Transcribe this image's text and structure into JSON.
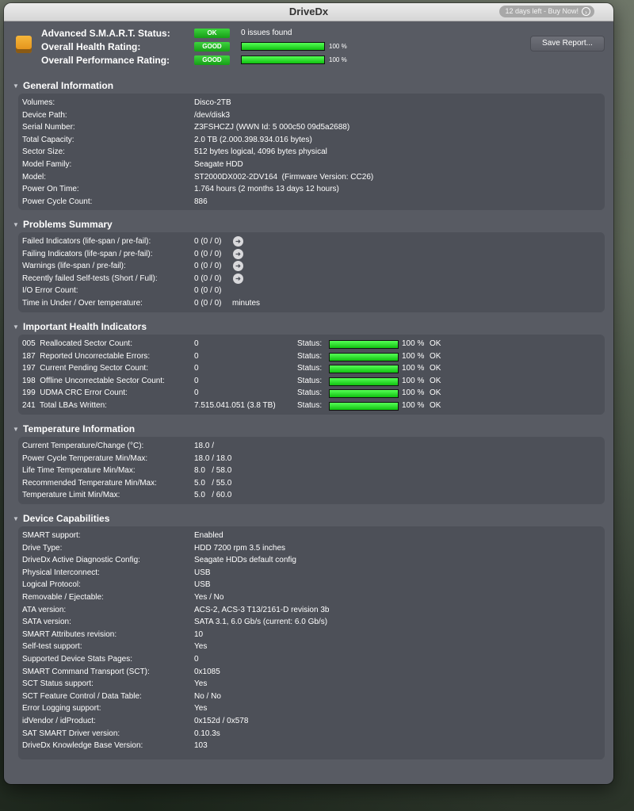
{
  "window": {
    "title": "DriveDx",
    "buy_text": "12 days left - Buy Now!"
  },
  "status": {
    "smart_label": "Advanced S.M.A.R.T. Status:",
    "smart_badge": "OK",
    "smart_issues": "0 issues found",
    "health_label": "Overall Health Rating:",
    "health_badge": "GOOD",
    "health_pct_text": "100 %",
    "health_value": 100,
    "perf_label": "Overall Performance Rating:",
    "perf_badge": "GOOD",
    "perf_pct_text": "100 %",
    "perf_value": 100,
    "save_label": "Save Report..."
  },
  "colors": {
    "good_green": "#2ebf2e",
    "bar_green": "#22e022",
    "panel": "#4d5058",
    "window": "#585b63"
  },
  "general": {
    "title": "General Information",
    "rows": [
      {
        "label": "Volumes:",
        "value": "Disco-2TB"
      },
      {
        "label": "Device Path:",
        "value": "/dev/disk3"
      },
      {
        "label": "Serial Number:",
        "value": "Z3FSHCZJ (WWN Id: 5 000c50 09d5a2688)"
      },
      {
        "label": "Total Capacity:",
        "value": "2.0 TB (2.000.398.934.016 bytes)"
      },
      {
        "label": "Sector Size:",
        "value": "512 bytes logical, 4096 bytes physical"
      },
      {
        "label": "Model Family:",
        "value": "Seagate HDD"
      },
      {
        "label": "Model:",
        "value": "ST2000DX002-2DV164  (Firmware Version: CC26)"
      },
      {
        "label": "Power On Time:",
        "value": "1.764 hours (2 months 13 days 12 hours)"
      },
      {
        "label": "Power Cycle Count:",
        "value": "886"
      }
    ]
  },
  "problems": {
    "title": "Problems Summary",
    "rows": [
      {
        "label": "Failed Indicators (life-span / pre-fail):",
        "value": "0 (0 / 0)",
        "icon": "go-arrow-icon",
        "unit": ""
      },
      {
        "label": "Failing Indicators (life-span / pre-fail):",
        "value": "0 (0 / 0)",
        "icon": "go-arrow-icon",
        "unit": ""
      },
      {
        "label": "Warnings (life-span / pre-fail):",
        "value": "0 (0 / 0)",
        "icon": "go-arrow-icon",
        "unit": ""
      },
      {
        "label": "Recently failed Self-tests (Short / Full):",
        "value": "0 (0 / 0)",
        "icon": "go-arrow-icon",
        "unit": ""
      },
      {
        "label": "I/O Error Count:",
        "value": "0 (0 / 0)",
        "icon": "",
        "unit": ""
      },
      {
        "label": "Time in Under / Over temperature:",
        "value": "0 (0 / 0)",
        "icon": "",
        "unit": "minutes"
      }
    ]
  },
  "health": {
    "title": "Important Health Indicators",
    "rows": [
      {
        "label": "005  Reallocated Sector Count:",
        "value": "0",
        "status_label": "Status:",
        "pct_text": "100 %",
        "pct": 100,
        "state": "OK"
      },
      {
        "label": "187  Reported Uncorrectable Errors:",
        "value": "0",
        "status_label": "Status:",
        "pct_text": "100 %",
        "pct": 100,
        "state": "OK"
      },
      {
        "label": "197  Current Pending Sector Count:",
        "value": "0",
        "status_label": "Status:",
        "pct_text": "100 %",
        "pct": 100,
        "state": "OK"
      },
      {
        "label": "198  Offline Uncorrectable Sector Count:",
        "value": "0",
        "status_label": "Status:",
        "pct_text": "100 %",
        "pct": 100,
        "state": "OK"
      },
      {
        "label": "199  UDMA CRC Error Count:",
        "value": "0",
        "status_label": "Status:",
        "pct_text": "100 %",
        "pct": 100,
        "state": "OK"
      },
      {
        "label": "241  Total LBAs Written:",
        "value": "7.515.041.051 (3.8 TB)",
        "status_label": "Status:",
        "pct_text": "100 %",
        "pct": 100,
        "state": "OK"
      }
    ]
  },
  "temperature": {
    "title": "Temperature Information",
    "rows": [
      {
        "label": "Current Temperature/Change (°C):",
        "value": "18.0 /"
      },
      {
        "label": "Power Cycle Temperature Min/Max:",
        "value": "18.0 / 18.0"
      },
      {
        "label": "Life Time Temperature Min/Max:",
        "value": "8.0   / 58.0"
      },
      {
        "label": "Recommended Temperature Min/Max:",
        "value": "5.0   / 55.0"
      },
      {
        "label": "Temperature Limit Min/Max:",
        "value": "5.0   / 60.0"
      }
    ]
  },
  "capabilities": {
    "title": "Device Capabilities",
    "rows": [
      {
        "label": "SMART support:",
        "value": "Enabled"
      },
      {
        "label": "Drive Type:",
        "value": "HDD 7200 rpm 3.5 inches"
      },
      {
        "label": "DriveDx Active Diagnostic Config:",
        "value": "Seagate HDDs default config"
      },
      {
        "label": "Physical Interconnect:",
        "value": "USB"
      },
      {
        "label": "Logical Protocol:",
        "value": "USB"
      },
      {
        "label": "Removable / Ejectable:",
        "value": "Yes / No"
      },
      {
        "label": "ATA version:",
        "value": "ACS-2, ACS-3 T13/2161-D revision 3b"
      },
      {
        "label": "SATA version:",
        "value": "SATA 3.1, 6.0 Gb/s (current: 6.0 Gb/s)"
      },
      {
        "label": "SMART Attributes revision:",
        "value": "10"
      },
      {
        "label": "Self-test support:",
        "value": "Yes"
      },
      {
        "label": "Supported Device Stats Pages:",
        "value": "0"
      },
      {
        "label": "SMART Command Transport (SCT):",
        "value": "0x1085"
      },
      {
        "label": "SCT Status support:",
        "value": "Yes"
      },
      {
        "label": "SCT Feature Control / Data Table:",
        "value": "No / No"
      },
      {
        "label": "Error Logging support:",
        "value": "Yes"
      },
      {
        "label": "idVendor / idProduct:",
        "value": "0x152d / 0x578"
      },
      {
        "label": "SAT SMART Driver version:",
        "value": "0.10.3s"
      },
      {
        "label": "DriveDx Knowledge Base Version:",
        "value": "103"
      }
    ]
  }
}
